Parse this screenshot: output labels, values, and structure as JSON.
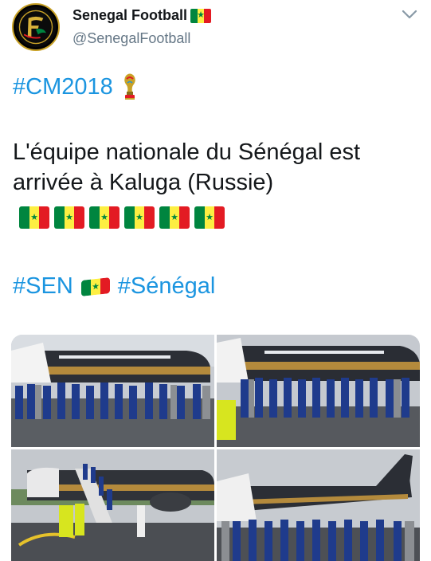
{
  "header": {
    "display_name": "Senegal Football",
    "handle": "@SenegalFootball",
    "avatar_icon": "senegal-football-logo-icon",
    "name_flag_icon": "senegal-flag-icon",
    "more_icon": "chevron-down-icon"
  },
  "tweet": {
    "hashtag_1": "#CM2018",
    "hashtag_1_icon": "world-cup-trophy-icon",
    "text_line_1": "L'équipe nationale du Sénégal est",
    "text_line_2": "arrivée à Kaluga (Russie)",
    "flag_count": 6,
    "flag_icon": "senegal-flag-icon",
    "hashtag_2": "#SEN",
    "hashtag_2_icon": "waving-senegal-flag-icon",
    "hashtag_3": "#Sénégal"
  },
  "media": {
    "photos": [
      {
        "name": "team-photo-front-of-plane"
      },
      {
        "name": "team-photo-front-of-plane-2"
      },
      {
        "name": "team-disembarking-plane"
      },
      {
        "name": "team-photo-under-plane-tail"
      }
    ]
  },
  "colors": {
    "hashtag": "#1b95e0",
    "text": "#14171a",
    "secondary": "#657786",
    "flag_green": "#00853f",
    "flag_yellow": "#fdef42",
    "flag_red": "#e31b23"
  }
}
